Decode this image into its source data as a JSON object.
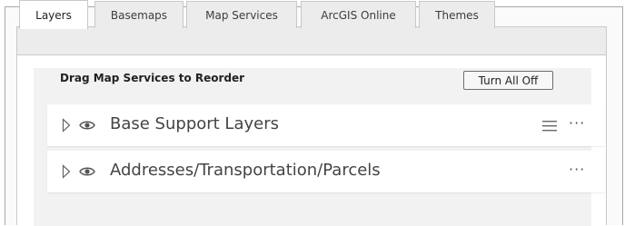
{
  "tabs": [
    {
      "label": "Layers",
      "active": true
    },
    {
      "label": "Basemaps",
      "active": false
    },
    {
      "label": "Map Services",
      "active": false
    },
    {
      "label": "ArcGIS Online",
      "active": false
    },
    {
      "label": "Themes",
      "active": false
    }
  ],
  "layers_panel": {
    "title": "Drag Map Services to Reorder",
    "turn_all_off_label": "Turn All Off",
    "services": [
      {
        "label": "Base Support Layers",
        "icons": [
          "expand-caret-icon",
          "eye-icon",
          "list-icon",
          "more-icon"
        ]
      },
      {
        "label": "Addresses/Transportation/Parcels",
        "icons": [
          "expand-caret-icon",
          "eye-icon",
          "more-icon"
        ]
      }
    ]
  },
  "glyphs": {
    "more": "···"
  },
  "colors": {
    "tab_bg": "#ececec",
    "panel_bg": "#f2f2f2",
    "text": "#444444",
    "border": "#c9c9c9"
  }
}
